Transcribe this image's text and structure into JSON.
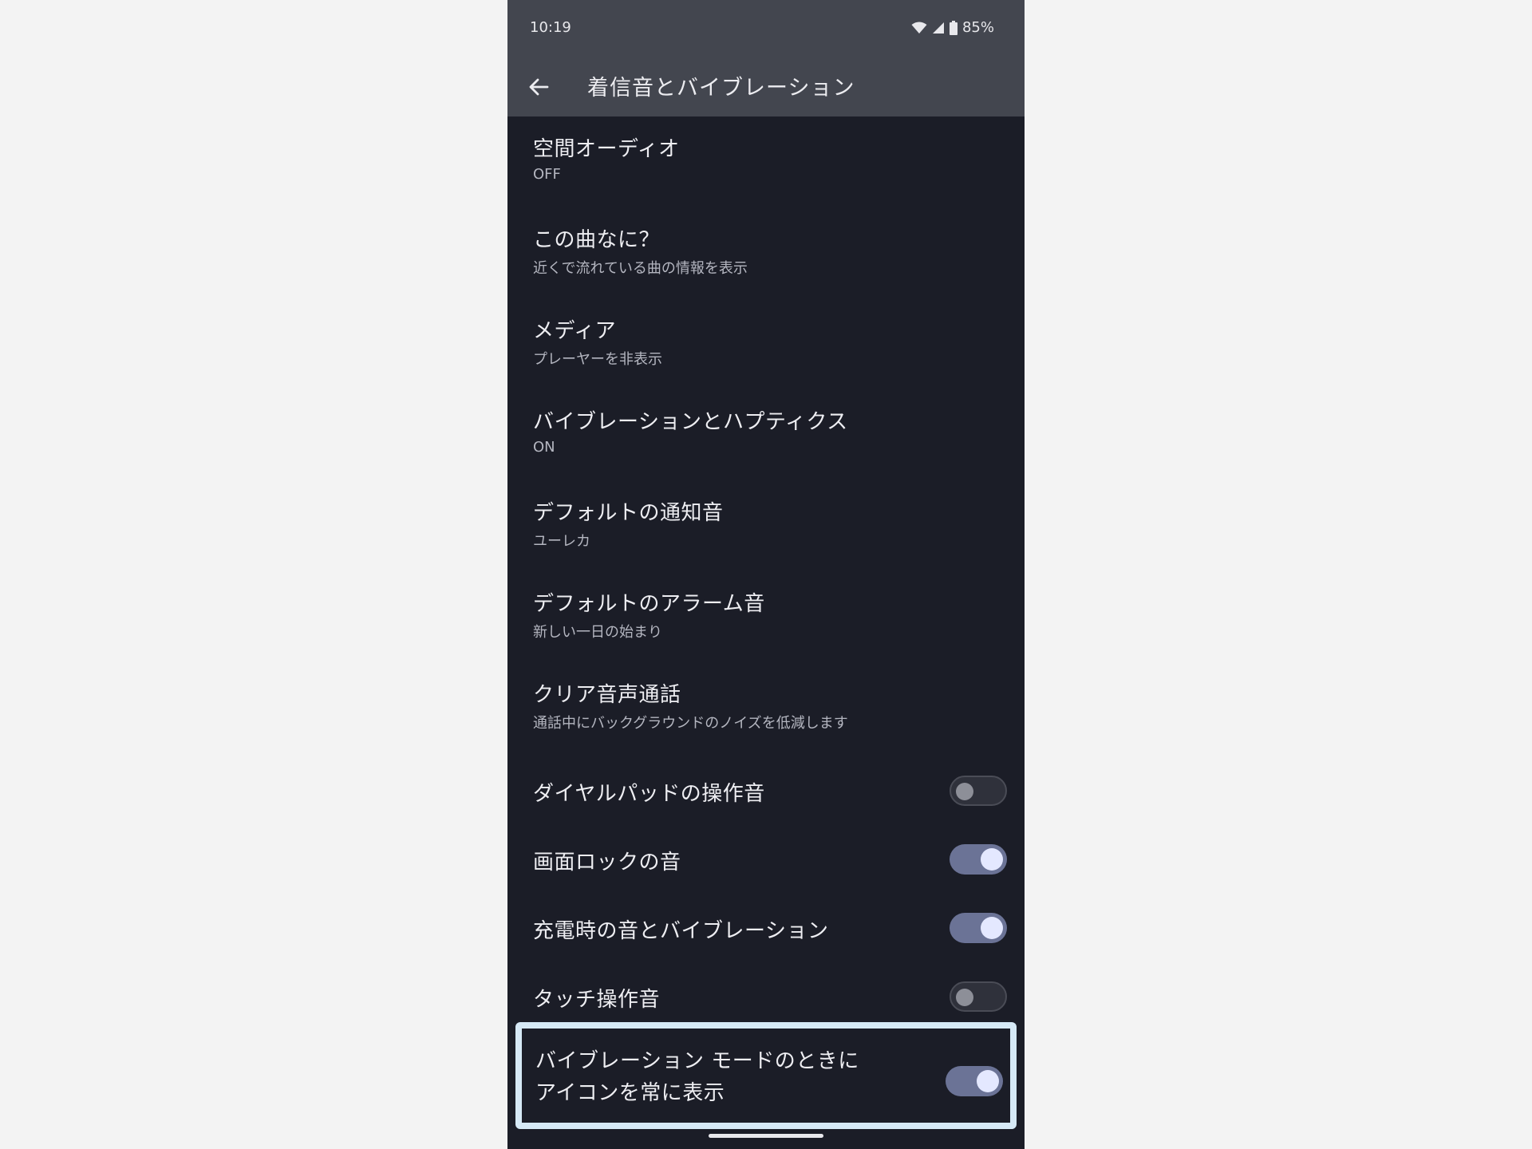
{
  "status_bar": {
    "time": "10:19",
    "battery": "85%",
    "icons": [
      "wifi-icon",
      "signal-icon",
      "battery-icon"
    ]
  },
  "app_bar": {
    "title": "着信音とバイブレーション",
    "back_icon": "arrow-left-icon"
  },
  "settings": [
    {
      "title": "空間オーディオ",
      "summary": "OFF"
    },
    {
      "title": "この曲なに？",
      "summary": "近くで流れている曲の情報を表示"
    },
    {
      "title": "メディア",
      "summary": "プレーヤーを非表示"
    },
    {
      "title": "バイブレーションとハプティクス",
      "summary": "ON"
    },
    {
      "title": "デフォルトの通知音",
      "summary": "ユーレカ"
    },
    {
      "title": "デフォルトのアラーム音",
      "summary": "新しい一日の始まり"
    },
    {
      "title": "クリア音声通話",
      "summary": "通話中にバックグラウンドのノイズを低減します"
    }
  ],
  "toggles": [
    {
      "title": "ダイヤルパッドの操作音",
      "on": false
    },
    {
      "title": "画面ロックの音",
      "on": true
    },
    {
      "title": "充電時の音とバイブレーション",
      "on": true
    },
    {
      "title": "タッチ操作音",
      "on": false
    }
  ],
  "highlighted_toggle": {
    "title_line1": "バイブレーション モードのときに",
    "title_line2": "アイコンを常に表示",
    "on": true
  },
  "colors": {
    "background": "#1b1d27",
    "app_bar": "#43464f",
    "toggle_on_track": "#6b7396",
    "toggle_on_knob": "#e4e8ff",
    "highlight_border": "#d6e9f6"
  }
}
